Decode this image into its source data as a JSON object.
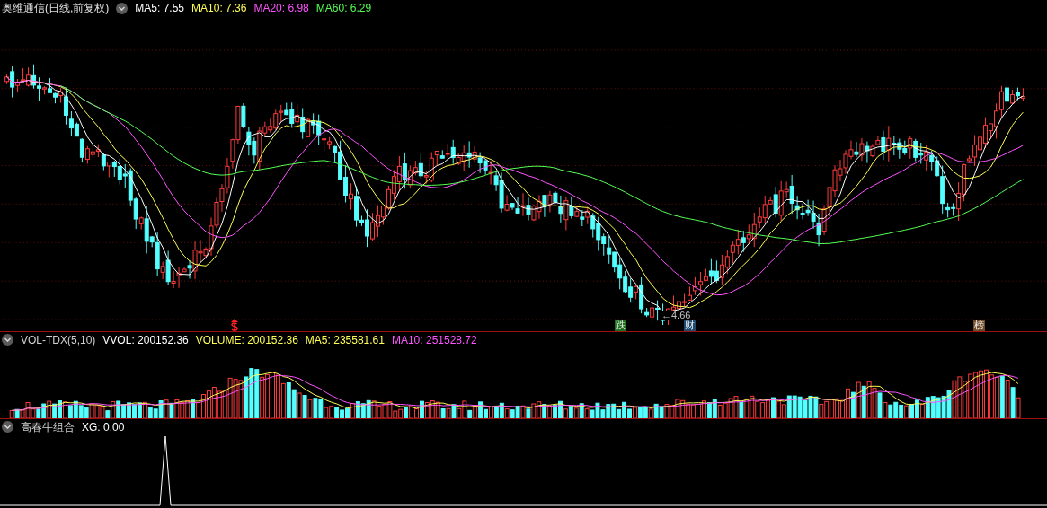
{
  "main_pane": {
    "title": "奥维通信(日线,前复权)",
    "legend": [
      {
        "label": "MA5: 7.55",
        "color": "#ffffff"
      },
      {
        "label": "MA10: 7.36",
        "color": "#ffff54"
      },
      {
        "label": "MA20: 6.98",
        "color": "#ff54ff"
      },
      {
        "label": "MA60: 6.29",
        "color": "#54ff54"
      }
    ],
    "low_label": "←4.66",
    "markers": [
      {
        "label": "跌",
        "color": "#1d6e1d"
      },
      {
        "label": "财",
        "color": "#1f4a6e"
      },
      {
        "label": "榜",
        "color": "#6e4a26"
      }
    ]
  },
  "volume_pane": {
    "title": "VOL-TDX(5,10)",
    "legend": [
      {
        "label": "VVOL: 200152.36",
        "color": "#ffffff"
      },
      {
        "label": "VOLUME: 200152.36",
        "color": "#ffff54"
      },
      {
        "label": "MA5: 235581.61",
        "color": "#ffff54"
      },
      {
        "label": "MA10: 251528.72",
        "color": "#ff54ff"
      }
    ]
  },
  "indicator_pane": {
    "title": "高春牛组合",
    "legend": [
      {
        "label": "XG: 0.00",
        "color": "#ffffff"
      }
    ]
  }
}
